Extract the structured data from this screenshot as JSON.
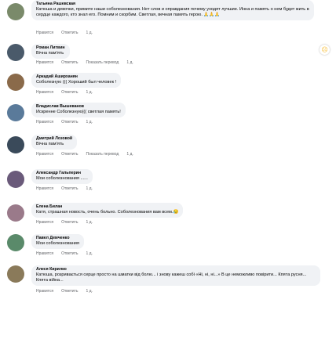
{
  "comments": [
    {
      "name": "Татьяна Рашевская",
      "text": "Катюша и девочки, примите наши соболезнования. Нет слов и оправдания почему уходят лучшие. Инна и память о нем будет жить в сердце каждого, кто знал его. Помним и скорбим. Светлая, вечная память герою. 🙏🙏🙏",
      "actions": [
        "Нравится",
        "Ответить",
        "1 д."
      ],
      "avatar_color": "#7a8a6a"
    },
    {
      "name": "Роман Литвин",
      "text": "Вічна пам'ять",
      "actions": [
        "Нравится",
        "Ответить",
        "Показать перевод",
        "1 д."
      ],
      "avatar_color": "#4a5a6a"
    },
    {
      "name": "Аркадий Аширханян",
      "text": "Соболезную ((( Хороший был человек !",
      "actions": [
        "Нравится",
        "Ответить",
        "1 д."
      ],
      "avatar_color": "#8a6a4a"
    },
    {
      "name": "Владислав Вышеванов",
      "text": "Искренне Соболезную((( светлая память!",
      "actions": [
        "Нравится",
        "Ответить",
        "1 д."
      ],
      "avatar_color": "#5a7a9a"
    },
    {
      "name": "Дмитрий Лозовой",
      "text": "Вічна пам'ять",
      "actions": [
        "Нравится",
        "Ответить",
        "Показать перевод",
        "1 д."
      ],
      "avatar_color": "#3a4a5a"
    },
    {
      "name": "Александр Гальперин",
      "text": "Мои соболезнования ......",
      "actions": [
        "Нравится",
        "Ответить",
        "1 д."
      ],
      "avatar_color": "#6a5a7a"
    },
    {
      "name": "Елена Билан",
      "text": "Катя, страшная новость, очень больно. Соболезнования вам всем.😥",
      "actions": [
        "Нравится",
        "Ответить",
        "1 д."
      ],
      "avatar_color": "#9a7a8a"
    },
    {
      "name": "Павел Демченко",
      "text": "Мои соболезнования",
      "actions": [
        "Нравится",
        "Ответить",
        "1 д."
      ],
      "avatar_color": "#5a8a6a"
    },
    {
      "name": "Алеся Кирилко",
      "text": "Катюша, розривається серце просто на шматки від болю... і знову кажеш собі «Ні, ні, ні...» В це неможливо повірити... Кпята русня... Кпята війна...",
      "actions": [
        "Нравится",
        "Ответить",
        "1 д."
      ],
      "avatar_color": "#8a7a5a"
    }
  ],
  "reaction_icon": "sad-face-emoji",
  "colors": {
    "bubble": "#f0f2f5",
    "meta": "#65676b",
    "text": "#050505"
  }
}
